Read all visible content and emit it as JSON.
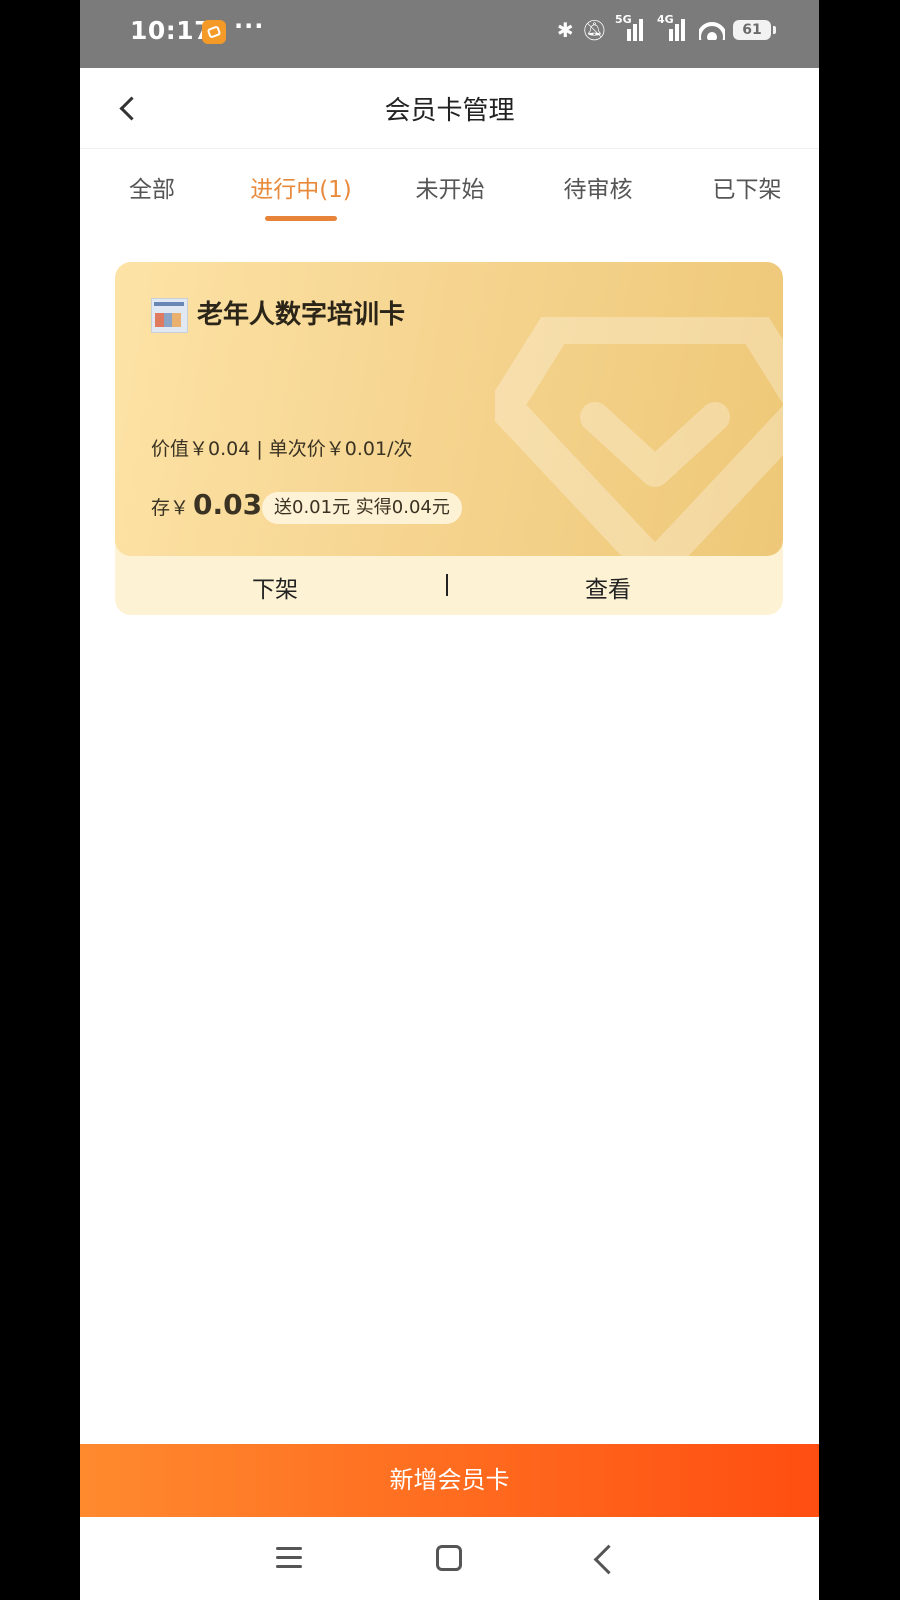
{
  "status_bar": {
    "time": "10:17",
    "more": "···",
    "signal1": "5G",
    "signal2": "4G",
    "battery": "61"
  },
  "header": {
    "title": "会员卡管理"
  },
  "tabs": [
    {
      "label": "全部",
      "active": false
    },
    {
      "label": "进行中(1)",
      "active": true
    },
    {
      "label": "未开始",
      "active": false
    },
    {
      "label": "待审核",
      "active": false
    },
    {
      "label": "已下架",
      "active": false
    }
  ],
  "card": {
    "name": "老年人数字培训卡",
    "price_line": "价值￥0.04 | 单次价￥0.01/次",
    "stock_label": "存￥",
    "stock_amount": "0.03",
    "bonus": "送0.01元  实得0.04元",
    "action_delist": "下架",
    "action_view": "查看"
  },
  "footer": {
    "add_button": "新增会员卡"
  },
  "colors": {
    "accent": "#e88a3c",
    "button_start": "#ff8a2e",
    "button_end": "#ff4e11",
    "card_bg": "#f6d591"
  }
}
